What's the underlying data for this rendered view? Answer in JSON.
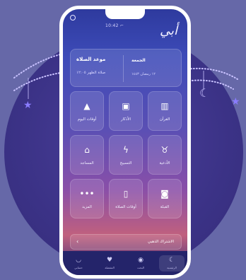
{
  "app": {
    "status_center": "10:42 ⌐",
    "logo": "أبي"
  },
  "top_card": {
    "prayer_name": "موعد الصلاة",
    "prayer_time": "صلاة الظهر ١٢:٠٥",
    "date_main": "الجمعة",
    "date_sub": "١٢ رمضان ١٤٤٣"
  },
  "grid": {
    "tiles": [
      {
        "label": "أوقات اليوم",
        "icon": "mosque-icon"
      },
      {
        "label": "الأذكار",
        "icon": "chat-icon"
      },
      {
        "label": "القرآن",
        "icon": "book-icon"
      },
      {
        "label": "المساجد",
        "icon": "mosque-icon"
      },
      {
        "label": "التسبيح",
        "icon": "lightning-icon"
      },
      {
        "label": "الأدعية",
        "icon": "hands-icon"
      },
      {
        "label": "المزيد",
        "icon": "dots-icon"
      },
      {
        "label": "أوقات الصلاة",
        "icon": "door-icon"
      },
      {
        "label": "القبلة",
        "icon": "kaaba-icon"
      }
    ]
  },
  "banner": {
    "text": "الاشتراك الذهبي",
    "arrow": "‹"
  },
  "tabbar": {
    "tabs": [
      {
        "label": "حسابي",
        "icon": "user-icon"
      },
      {
        "label": "المفضلة",
        "icon": "heart-icon"
      },
      {
        "label": "البحث",
        "icon": "search-icon"
      },
      {
        "label": "الرئيسية",
        "icon": "moon-icon"
      }
    ]
  }
}
